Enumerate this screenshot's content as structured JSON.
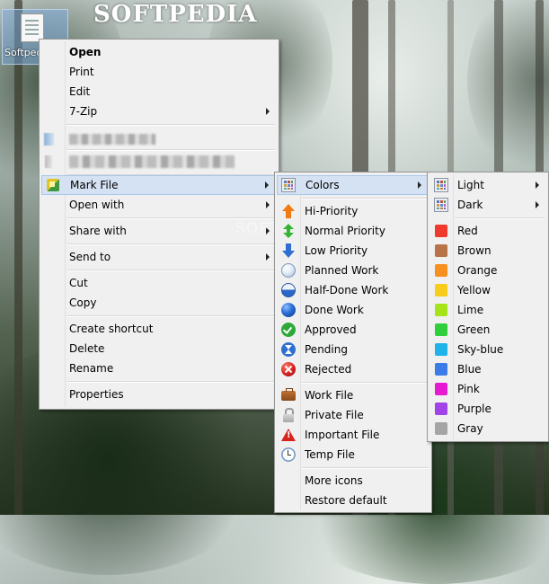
{
  "desktop": {
    "watermark": "SOFTPEDIA",
    "watermark_ghost": "SOFTPE",
    "icon_label": "Softped"
  },
  "context_menu": {
    "items": [
      {
        "label": "Open"
      },
      {
        "label": "Print"
      },
      {
        "label": "Edit"
      },
      {
        "label": "7-Zip"
      },
      {
        "label": "Mark File"
      },
      {
        "label": "Open with"
      },
      {
        "label": "Share with"
      },
      {
        "label": "Send to"
      },
      {
        "label": "Cut"
      },
      {
        "label": "Copy"
      },
      {
        "label": "Create shortcut"
      },
      {
        "label": "Delete"
      },
      {
        "label": "Rename"
      },
      {
        "label": "Properties"
      }
    ]
  },
  "mark_file_menu": {
    "items": [
      {
        "label": "Colors",
        "icon": "palette-grid-icon"
      },
      {
        "label": "Hi-Priority",
        "icon": "arrow-up-icon"
      },
      {
        "label": "Normal Priority",
        "icon": "arrow-up-down-icon"
      },
      {
        "label": "Low Priority",
        "icon": "arrow-down-icon"
      },
      {
        "label": "Planned Work",
        "icon": "empty-ball-icon"
      },
      {
        "label": "Half-Done Work",
        "icon": "half-ball-icon"
      },
      {
        "label": "Done Work",
        "icon": "full-ball-icon"
      },
      {
        "label": "Approved",
        "icon": "checkmark-icon"
      },
      {
        "label": "Pending",
        "icon": "hourglass-icon"
      },
      {
        "label": "Rejected",
        "icon": "reject-x-icon"
      },
      {
        "label": "Work File",
        "icon": "briefcase-icon"
      },
      {
        "label": "Private File",
        "icon": "lock-icon"
      },
      {
        "label": "Important File",
        "icon": "warning-icon"
      },
      {
        "label": "Temp File",
        "icon": "clock-icon"
      },
      {
        "label": "More icons"
      },
      {
        "label": "Restore default"
      }
    ]
  },
  "colors_menu": {
    "items": [
      {
        "label": "Light"
      },
      {
        "label": "Dark"
      },
      {
        "label": "Red",
        "color": "#f03a2e"
      },
      {
        "label": "Brown",
        "color": "#b87348"
      },
      {
        "label": "Orange",
        "color": "#f6901e"
      },
      {
        "label": "Yellow",
        "color": "#f8cc1d"
      },
      {
        "label": "Lime",
        "color": "#a6e31a"
      },
      {
        "label": "Green",
        "color": "#2fcf3b"
      },
      {
        "label": "Sky-blue",
        "color": "#1fb3e9"
      },
      {
        "label": "Blue",
        "color": "#3b7ce8"
      },
      {
        "label": "Pink",
        "color": "#e61ad0"
      },
      {
        "label": "Purple",
        "color": "#a143e8"
      },
      {
        "label": "Gray",
        "color": "#a5a5a5"
      }
    ]
  },
  "colors": {
    "menu_bg": "#f0f0f0",
    "highlight": "#d5e2f3",
    "highlight_border": "#aac6ea"
  }
}
